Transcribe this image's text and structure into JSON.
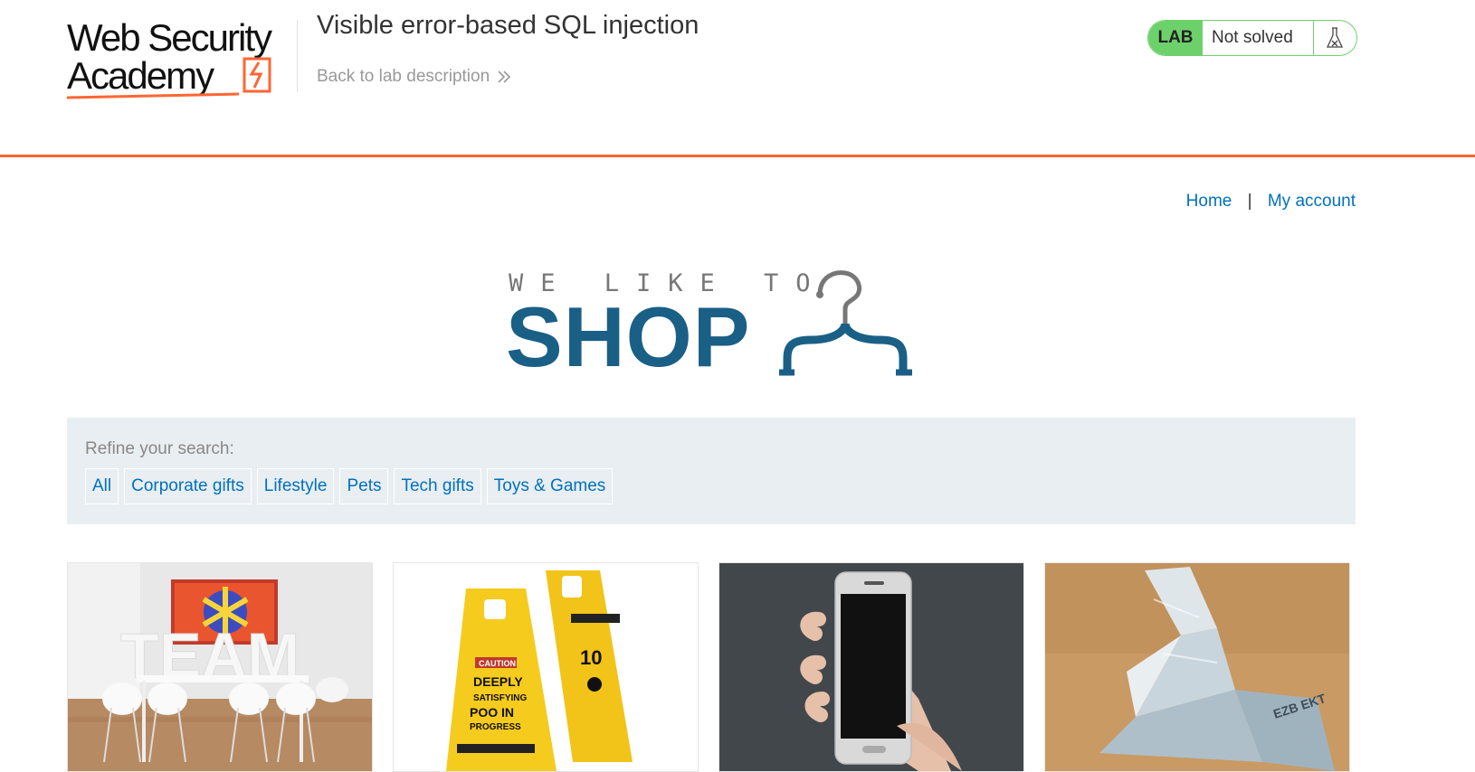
{
  "academy": {
    "logo_line1": "Web Security",
    "logo_line2": "Academy",
    "lab_title": "Visible error-based SQL injection",
    "back_link": "Back to lab description",
    "lab_badge": "LAB",
    "lab_status": "Not solved",
    "status_icon": "flask-icon",
    "colors": {
      "accent": "#ff6633",
      "lab_green": "#6dd16b",
      "link": "#0071bc"
    }
  },
  "nav": {
    "home": "Home",
    "separator": "|",
    "my_account": "My account"
  },
  "shop_logo": {
    "tagline": "WE LIKE TO",
    "word": "SHOP",
    "icon": "hanger-icon",
    "color": "#1a5f86"
  },
  "search": {
    "label": "Refine your search:",
    "filters": [
      "All",
      "Corporate gifts",
      "Lifestyle",
      "Pets",
      "Tech gifts",
      "Toys & Games"
    ]
  },
  "products": [
    {
      "image": "team-room-image"
    },
    {
      "image": "caution-signs-image"
    },
    {
      "image": "smartphone-hand-image"
    },
    {
      "image": "origami-euro-bird-image"
    }
  ]
}
